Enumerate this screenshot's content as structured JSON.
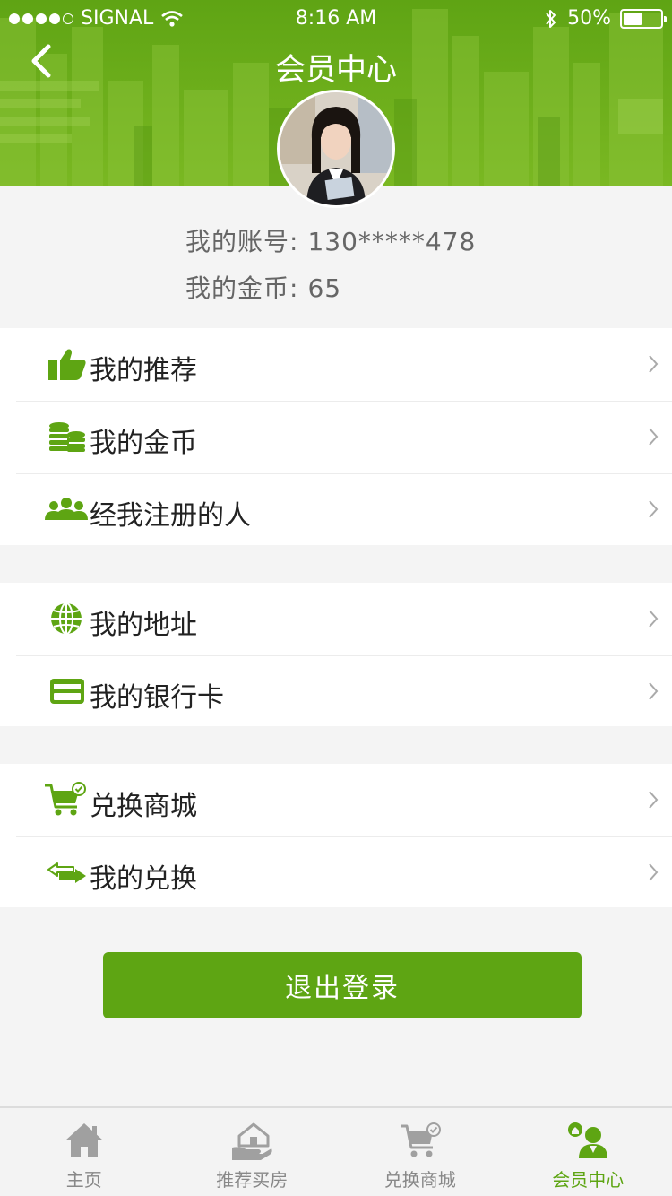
{
  "status_bar": {
    "carrier": "SIGNAL",
    "time": "8:16 AM",
    "battery": "50%",
    "battery_level": 0.5
  },
  "header": {
    "title": "会员中心",
    "back_icon": "chevron-left-icon",
    "avatar_icon": "avatar"
  },
  "profile": {
    "account_label": "我的账号:",
    "account_value": "130*****478",
    "coins_label": "我的金币:",
    "coins_value": "65"
  },
  "menu": {
    "group1": [
      {
        "label": "我的推荐",
        "icon": "thumbs-up-icon"
      },
      {
        "label": "我的金币",
        "icon": "coins-icon"
      },
      {
        "label": "经我注册的人",
        "icon": "users-icon"
      }
    ],
    "group2": [
      {
        "label": "我的地址",
        "icon": "globe-icon"
      },
      {
        "label": "我的银行卡",
        "icon": "bank-card-icon"
      }
    ],
    "group3": [
      {
        "label": "兑换商城",
        "icon": "cart-check-icon"
      },
      {
        "label": "我的兑换",
        "icon": "exchange-icon"
      }
    ]
  },
  "logout_label": "退出登录",
  "tabbar": {
    "tabs": [
      {
        "label": "主页",
        "icon": "home-icon",
        "active": false
      },
      {
        "label": "推荐买房",
        "icon": "house-hand-icon",
        "active": false
      },
      {
        "label": "兑换商城",
        "icon": "cart-icon",
        "active": false
      },
      {
        "label": "会员中心",
        "icon": "member-icon",
        "active": true
      }
    ]
  },
  "colors": {
    "brand_green": "#5ea513",
    "header_green": "#6aae1a",
    "tab_inactive": "#888888"
  }
}
